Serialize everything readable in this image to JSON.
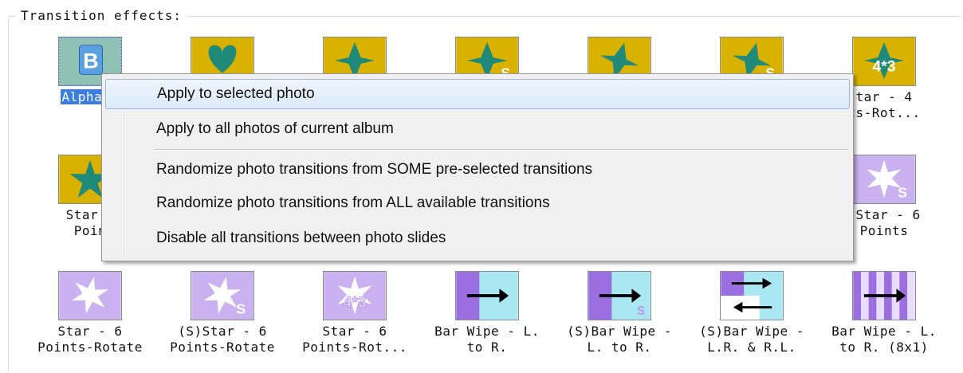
{
  "group_title": "Transition effects:",
  "tiles": [
    {
      "label": "Alpha B"
    },
    {
      "label": ""
    },
    {
      "label": ""
    },
    {
      "label": ""
    },
    {
      "label": ""
    },
    {
      "label": ""
    },
    {
      "label": "tar - 4\nts-Rot..."
    },
    {
      "label": "Star -\nPoin"
    },
    {
      "label": ")Star - 6\nPoints"
    },
    {
      "label": "Star - 6\nPoints-Rotate"
    },
    {
      "label": "(S)Star - 6\nPoints-Rotate"
    },
    {
      "label": "Star - 6\nPoints-Rot..."
    },
    {
      "label": "Bar Wipe - L.\nto R."
    },
    {
      "label": "(S)Bar Wipe -\nL. to R."
    },
    {
      "label": "(S)Bar Wipe -\nL.R. & R.L."
    },
    {
      "label": "Bar Wipe - L.\nto R. (8x1)"
    }
  ],
  "thumb_marks": {
    "s": "S",
    "grid": "4*3"
  },
  "context_menu": {
    "items": [
      {
        "label": "Apply to selected photo"
      },
      {
        "label": "Apply to all photos of current album"
      },
      {
        "label": "Randomize photo transitions from SOME pre-selected transitions"
      },
      {
        "label": "Randomize photo transitions from ALL available transitions"
      },
      {
        "label": "Disable all transitions between photo slides"
      }
    ]
  },
  "colors": {
    "gold": "#d9b200",
    "teal": "#1f8a7a",
    "lavender": "#c9b2ef",
    "purple": "#9b6fe0",
    "cyan": "#a9e8f2",
    "highlight": "#3b7de0"
  }
}
